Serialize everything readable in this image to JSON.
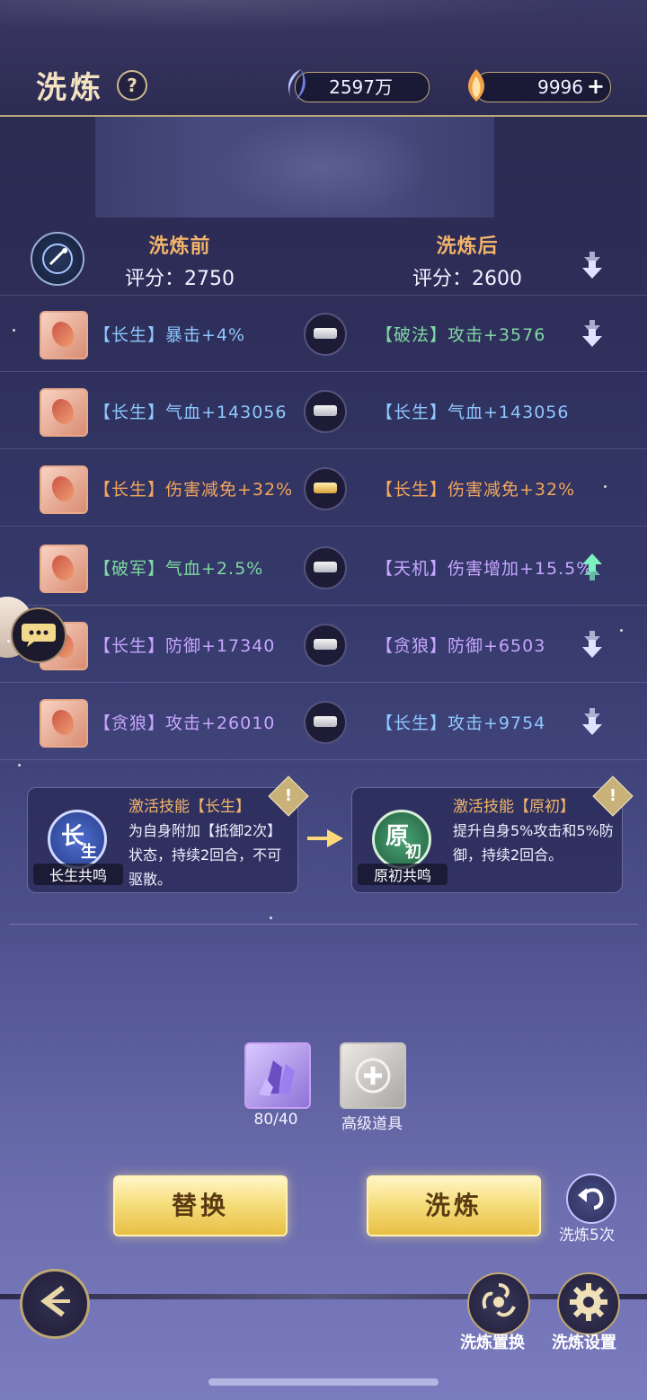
{
  "header": {
    "title": "洗炼",
    "help_icon": "?",
    "currency1_value": "2597万",
    "currency2_value": "9996",
    "currency2_add": "+"
  },
  "compare": {
    "before_title": "洗炼前",
    "before_score": "评分：2750",
    "after_title": "洗炼后",
    "after_score": "评分：2600"
  },
  "rows": [
    {
      "left_tag": "【长生】",
      "left_stat": "暴击+4%",
      "right_tag": "【破法】",
      "right_stat": "攻击+3576",
      "left_color": "#8fc8ff",
      "right_color": "#7fd8a2",
      "lock": "silver",
      "change": "down"
    },
    {
      "left_tag": "【长生】",
      "left_stat": "气血+143056",
      "right_tag": "【长生】",
      "right_stat": "气血+143056",
      "left_color": "#8fc8ff",
      "right_color": "#8fc8ff",
      "lock": "silver",
      "change": "none"
    },
    {
      "left_tag": "【长生】",
      "left_stat": "伤害减免+32%",
      "right_tag": "【长生】",
      "right_stat": "伤害减免+32%",
      "left_color": "#f3a65c",
      "right_color": "#f3a65c",
      "lock": "gold",
      "change": "none"
    },
    {
      "left_tag": "【破军】",
      "left_stat": "气血+2.5%",
      "right_tag": "【天机】",
      "right_stat": "伤害增加+15.5%",
      "left_color": "#7fd8a2",
      "right_color": "#c7a6ff",
      "lock": "silver",
      "change": "up"
    },
    {
      "left_tag": "【长生】",
      "left_stat": "防御+17340",
      "right_tag": "【贪狼】",
      "right_stat": "防御+6503",
      "left_color": "#c7a6ff",
      "right_color": "#c7a6ff",
      "lock": "silver",
      "change": "down"
    },
    {
      "left_tag": "【贪狼】",
      "left_stat": "攻击+26010",
      "right_tag": "【长生】",
      "right_stat": "攻击+9754",
      "left_color": "#c7a6ff",
      "right_color": "#8fc8ff",
      "lock": "silver",
      "change": "down"
    }
  ],
  "skills": {
    "left": {
      "badge_main": "长",
      "badge_sub": "生",
      "caption": "长生共鸣",
      "title": "激活技能【长生】",
      "desc": "为自身附加【抵御2次】状态，持续2回合，不可驱散。"
    },
    "right": {
      "badge_main": "原",
      "badge_sub": "初",
      "caption": "原初共鸣",
      "title": "激活技能【原初】",
      "desc": "提升自身5%攻击和5%防御，持续2回合。"
    },
    "warn": "!"
  },
  "materials": {
    "crystal_count": "80/40",
    "add_label": "高级道具"
  },
  "actions": {
    "replace": "替换",
    "refine": "洗炼",
    "refine5": "洗炼5次",
    "reset": "洗炼置换",
    "settings": "洗炼设置"
  },
  "icons": {
    "help": "question-icon",
    "currency1": "moon-crystal-icon",
    "currency2": "flame-gem-icon",
    "undo": "undo-arrow-icon",
    "back": "back-arrow-icon",
    "reset": "swirl-icon",
    "settings": "gear-icon",
    "chat": "chat-bubble-icon"
  },
  "colors": {
    "accent_gold": "#f3b46a",
    "arrow_down": "#dfe3ff",
    "arrow_up": "#7df0c0"
  }
}
